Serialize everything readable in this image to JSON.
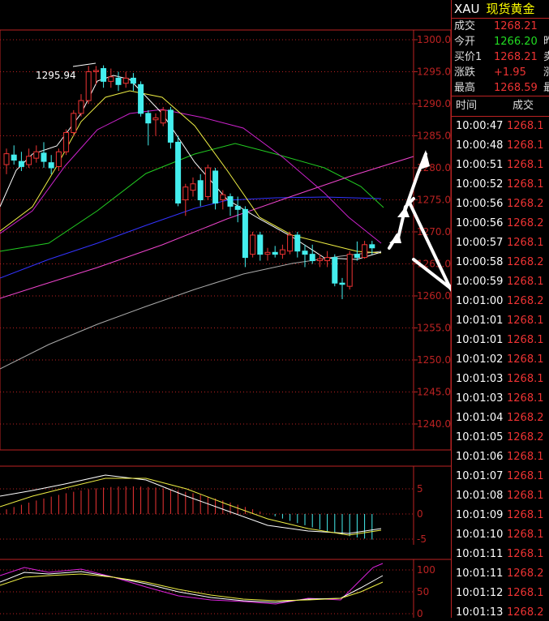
{
  "header": {
    "symbol": "XAU",
    "name": "现货黄金"
  },
  "quote": [
    {
      "label": "成交",
      "value": "1268.21",
      "color": "#e33",
      "extra": ""
    },
    {
      "label": "今开",
      "value": "1266.20",
      "color": "#2d2",
      "extra": "昨"
    },
    {
      "label": "买价1",
      "value": "1268.21",
      "color": "#e33",
      "extra": "卖"
    },
    {
      "label": "涨跌",
      "value": "+1.95",
      "color": "#e33",
      "extra": "涨"
    },
    {
      "label": "最高",
      "value": "1268.59",
      "color": "#e33",
      "extra": "最"
    }
  ],
  "ticks": {
    "col_time": "时间",
    "col_price": "成交",
    "rows": [
      {
        "time": "10:00:47",
        "price": "1268.1"
      },
      {
        "time": "10:00:48",
        "price": "1268.1"
      },
      {
        "time": "10:00:51",
        "price": "1268.1"
      },
      {
        "time": "10:00:52",
        "price": "1268.1"
      },
      {
        "time": "10:00:56",
        "price": "1268.2"
      },
      {
        "time": "10:00:56",
        "price": "1268.2"
      },
      {
        "time": "10:00:57",
        "price": "1268.1"
      },
      {
        "time": "10:00:58",
        "price": "1268.2"
      },
      {
        "time": "10:00:59",
        "price": "1268.1"
      },
      {
        "time": "10:01:00",
        "price": "1268.2"
      },
      {
        "time": "10:01:01",
        "price": "1268.1"
      },
      {
        "time": "10:01:01",
        "price": "1268.1"
      },
      {
        "time": "10:01:02",
        "price": "1268.1"
      },
      {
        "time": "10:01:03",
        "price": "1268.1"
      },
      {
        "time": "10:01:03",
        "price": "1268.1"
      },
      {
        "time": "10:01:04",
        "price": "1268.2"
      },
      {
        "time": "10:01:05",
        "price": "1268.2"
      },
      {
        "time": "10:01:06",
        "price": "1268.1"
      },
      {
        "time": "10:01:07",
        "price": "1268.1"
      },
      {
        "time": "10:01:08",
        "price": "1268.1"
      },
      {
        "time": "10:01:09",
        "price": "1268.1"
      },
      {
        "time": "10:01:10",
        "price": "1268.1"
      },
      {
        "time": "10:01:11",
        "price": "1268.1"
      },
      {
        "time": "10:01:11",
        "price": "1268.2"
      },
      {
        "time": "10:01:12",
        "price": "1268.1"
      },
      {
        "time": "10:01:13",
        "price": "1268.2"
      }
    ]
  },
  "chart_data": [
    {
      "type": "candlestick",
      "high_label": "1295.94",
      "y_ticks": [
        "1300.0",
        "1295.0",
        "1290.0",
        "1285.0",
        "1280.0",
        "1275.0",
        "1270.0",
        "1265.0",
        "1260.0",
        "1255.0",
        "1250.0",
        "1245.0",
        "1240.0"
      ],
      "ylim": [
        1237,
        1302
      ],
      "candles": [
        {
          "o": 1280.5,
          "c": 1282.2,
          "h": 1283.0,
          "l": 1279.0
        },
        {
          "o": 1282.0,
          "c": 1281.2,
          "h": 1283.5,
          "l": 1280.5
        },
        {
          "o": 1281.0,
          "c": 1280.2,
          "h": 1282.5,
          "l": 1279.5
        },
        {
          "o": 1280.5,
          "c": 1281.8,
          "h": 1283.0,
          "l": 1280.0
        },
        {
          "o": 1281.5,
          "c": 1282.5,
          "h": 1283.5,
          "l": 1280.8
        },
        {
          "o": 1282.3,
          "c": 1281.0,
          "h": 1284.0,
          "l": 1280.0
        },
        {
          "o": 1280.8,
          "c": 1280.0,
          "h": 1282.0,
          "l": 1279.0
        },
        {
          "o": 1280.2,
          "c": 1282.5,
          "h": 1283.0,
          "l": 1279.5
        },
        {
          "o": 1282.5,
          "c": 1285.5,
          "h": 1286.0,
          "l": 1282.0
        },
        {
          "o": 1285.5,
          "c": 1288.5,
          "h": 1289.0,
          "l": 1285.0
        },
        {
          "o": 1288.5,
          "c": 1290.5,
          "h": 1291.5,
          "l": 1288.0
        },
        {
          "o": 1290.5,
          "c": 1295.0,
          "h": 1295.9,
          "l": 1290.0
        },
        {
          "o": 1295.0,
          "c": 1295.2,
          "h": 1295.9,
          "l": 1293.0
        },
        {
          "o": 1295.5,
          "c": 1293.5,
          "h": 1296.0,
          "l": 1292.5
        },
        {
          "o": 1293.5,
          "c": 1294.2,
          "h": 1295.5,
          "l": 1292.5
        },
        {
          "o": 1294.0,
          "c": 1293.0,
          "h": 1295.0,
          "l": 1292.0
        },
        {
          "o": 1293.2,
          "c": 1294.0,
          "h": 1295.0,
          "l": 1292.5
        },
        {
          "o": 1294.0,
          "c": 1293.2,
          "h": 1294.8,
          "l": 1292.0
        },
        {
          "o": 1293.0,
          "c": 1288.5,
          "h": 1293.5,
          "l": 1288.0
        },
        {
          "o": 1288.5,
          "c": 1287.0,
          "h": 1289.0,
          "l": 1283.5
        },
        {
          "o": 1287.5,
          "c": 1287.8,
          "h": 1288.5,
          "l": 1285.0
        },
        {
          "o": 1287.0,
          "c": 1289.0,
          "h": 1289.5,
          "l": 1286.5
        },
        {
          "o": 1289.0,
          "c": 1284.0,
          "h": 1289.5,
          "l": 1283.0
        },
        {
          "o": 1284.0,
          "c": 1274.5,
          "h": 1285.0,
          "l": 1274.0
        },
        {
          "o": 1275.0,
          "c": 1277.0,
          "h": 1277.5,
          "l": 1272.5
        },
        {
          "o": 1276.5,
          "c": 1277.5,
          "h": 1278.5,
          "l": 1275.5
        },
        {
          "o": 1278.0,
          "c": 1275.0,
          "h": 1279.0,
          "l": 1274.0
        },
        {
          "o": 1275.5,
          "c": 1280.0,
          "h": 1280.5,
          "l": 1275.0
        },
        {
          "o": 1279.5,
          "c": 1274.5,
          "h": 1280.0,
          "l": 1273.5
        },
        {
          "o": 1275.0,
          "c": 1275.8,
          "h": 1276.5,
          "l": 1273.5
        },
        {
          "o": 1275.5,
          "c": 1274.0,
          "h": 1276.0,
          "l": 1272.5
        },
        {
          "o": 1274.0,
          "c": 1273.5,
          "h": 1275.5,
          "l": 1271.5
        },
        {
          "o": 1273.5,
          "c": 1266.0,
          "h": 1274.0,
          "l": 1264.5
        },
        {
          "o": 1266.5,
          "c": 1269.5,
          "h": 1270.0,
          "l": 1266.0
        },
        {
          "o": 1269.5,
          "c": 1266.5,
          "h": 1270.0,
          "l": 1265.5
        },
        {
          "o": 1266.5,
          "c": 1266.8,
          "h": 1267.5,
          "l": 1265.5
        },
        {
          "o": 1266.8,
          "c": 1266.5,
          "h": 1267.8,
          "l": 1266.0
        },
        {
          "o": 1266.5,
          "c": 1267.2,
          "h": 1268.0,
          "l": 1265.8
        },
        {
          "o": 1267.0,
          "c": 1269.5,
          "h": 1270.0,
          "l": 1266.5
        },
        {
          "o": 1269.5,
          "c": 1267.0,
          "h": 1270.0,
          "l": 1266.0
        },
        {
          "o": 1267.0,
          "c": 1266.5,
          "h": 1268.0,
          "l": 1264.5
        },
        {
          "o": 1266.5,
          "c": 1265.5,
          "h": 1268.0,
          "l": 1265.0
        },
        {
          "o": 1265.5,
          "c": 1265.8,
          "h": 1266.5,
          "l": 1264.5
        },
        {
          "o": 1265.5,
          "c": 1266.0,
          "h": 1267.0,
          "l": 1264.5
        },
        {
          "o": 1266.0,
          "c": 1262.0,
          "h": 1266.5,
          "l": 1261.5
        },
        {
          "o": 1262.0,
          "c": 1261.8,
          "h": 1262.8,
          "l": 1259.5
        },
        {
          "o": 1261.5,
          "c": 1266.5,
          "h": 1267.0,
          "l": 1261.0
        },
        {
          "o": 1266.5,
          "c": 1266.0,
          "h": 1268.5,
          "l": 1265.5
        },
        {
          "o": 1266.0,
          "c": 1268.0,
          "h": 1268.6,
          "l": 1265.8
        },
        {
          "o": 1268.0,
          "c": 1267.5,
          "h": 1268.6,
          "l": 1266.5
        }
      ]
    },
    {
      "type": "bar",
      "y_ticks": [
        "5",
        "0",
        "-5"
      ],
      "ylim": [
        -6,
        8
      ]
    },
    {
      "type": "line",
      "y_ticks": [
        "100",
        "50",
        "0"
      ],
      "ylim": [
        -5,
        110
      ]
    }
  ]
}
